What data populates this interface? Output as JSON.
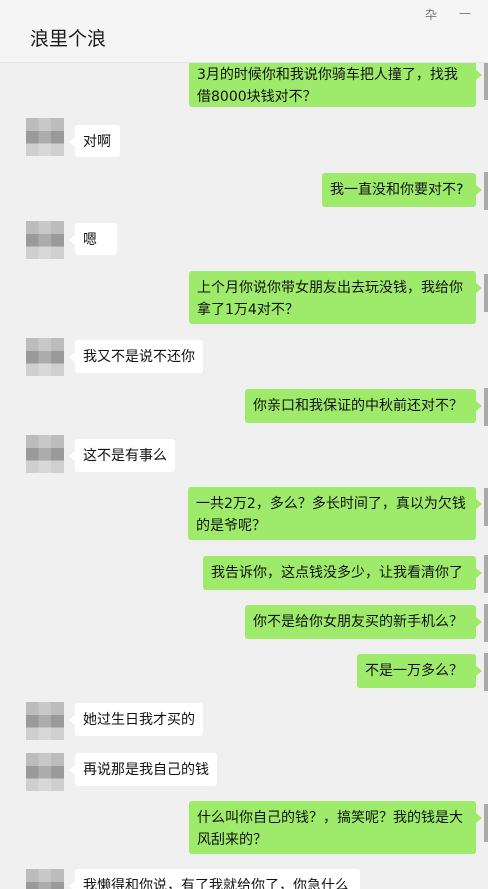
{
  "window": {
    "title": "浪里个浪",
    "controls": {
      "pin": "卆",
      "minimize": "—"
    }
  },
  "messages": [
    {
      "side": "out",
      "text": "3月的时候你和我说你骑车把人撞了，找我借8000块钱对不？"
    },
    {
      "side": "in",
      "text": "对啊"
    },
    {
      "side": "out",
      "text": "我一直没和你要对不?"
    },
    {
      "side": "in",
      "text": "嗯"
    },
    {
      "side": "out",
      "text": "上个月你说你带女朋友出去玩没钱，我给你拿了1万4对不？"
    },
    {
      "side": "in",
      "text": "我又不是说不还你"
    },
    {
      "side": "out",
      "text": "你亲口和我保证的中秋前还对不？"
    },
    {
      "side": "in",
      "text": "这不是有事么"
    },
    {
      "side": "out",
      "text": "一共2万2，多么？多长时间了，真以为欠钱的是爷呢？"
    },
    {
      "side": "out",
      "text": "我告诉你，这点钱没多少，让我看清你了"
    },
    {
      "side": "out",
      "text": "你不是给你女朋友买的新手机么？"
    },
    {
      "side": "out",
      "text": "不是一万多么？"
    },
    {
      "side": "in",
      "text": "她过生日我才买的"
    },
    {
      "side": "in",
      "text": "再说那是我自己的钱"
    },
    {
      "side": "out",
      "text": "什么叫你自己的钱？，搞笑呢？我的钱是大风刮来的？"
    },
    {
      "side": "in",
      "text": "我懒得和你说，有了我就给你了，你急什么"
    }
  ]
}
